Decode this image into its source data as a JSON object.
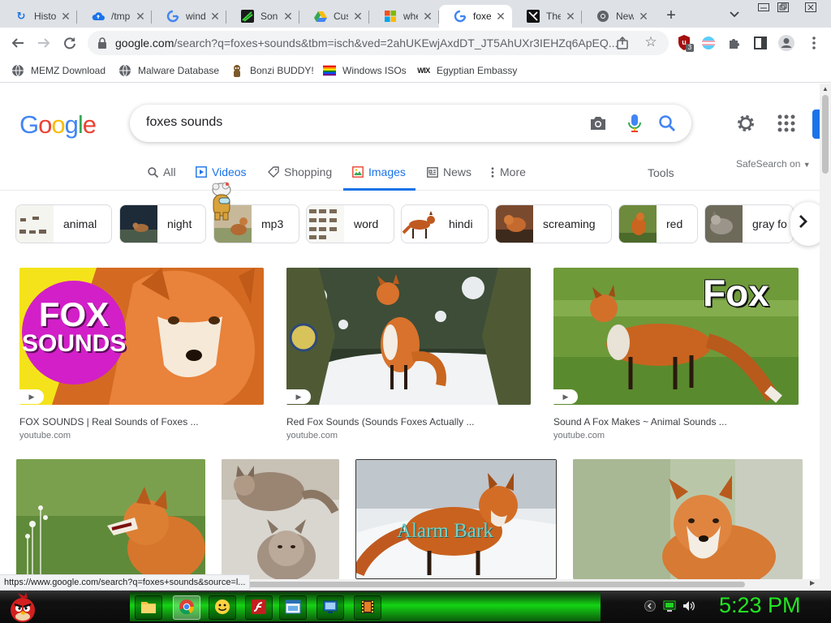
{
  "tabs": [
    {
      "title": "Histo",
      "icon": "history-icon"
    },
    {
      "title": "/tmp",
      "icon": "cloud-icon"
    },
    {
      "title": "wind",
      "icon": "google-icon"
    },
    {
      "title": "Soni",
      "icon": "sonic-icon"
    },
    {
      "title": "Cust",
      "icon": "drive-icon"
    },
    {
      "title": "whe",
      "icon": "microsoft-icon"
    },
    {
      "title": "foxe",
      "icon": "google-icon"
    },
    {
      "title": "The",
      "icon": "site-icon"
    },
    {
      "title": "New",
      "icon": "chrome-icon"
    }
  ],
  "toolbar": {
    "url_host": "google.com",
    "url_rest": "/search?q=foxes+sounds&tbm=isch&ved=2ahUKEwjAxdDT_JT5AhUXr3IEHZq6ApEQ...",
    "ext_badge": "3"
  },
  "bookmarks": [
    {
      "label": "MEMZ Download"
    },
    {
      "label": "Malware Database"
    },
    {
      "label": "Bonzi BUDDY!"
    },
    {
      "label": "Windows ISOs"
    },
    {
      "label": "Egyptian Embassy"
    }
  ],
  "google": {
    "logo": "Google",
    "query": "foxes sounds",
    "safesearch": "SafeSearch on",
    "tools": "Tools",
    "nav": [
      {
        "label": "All"
      },
      {
        "label": "Videos"
      },
      {
        "label": "Shopping"
      },
      {
        "label": "Images"
      },
      {
        "label": "News"
      },
      {
        "label": "More"
      }
    ],
    "chips": [
      {
        "label": "animal"
      },
      {
        "label": "night"
      },
      {
        "label": "mp3"
      },
      {
        "label": "word"
      },
      {
        "label": "hindi"
      },
      {
        "label": "screaming"
      },
      {
        "label": "red"
      },
      {
        "label": "gray fo"
      }
    ],
    "results": [
      {
        "title": "FOX SOUNDS | Real Sounds of Foxes ...",
        "source": "youtube.com",
        "badge_line1": "FOX",
        "badge_line2": "SOUNDS"
      },
      {
        "title": "Red Fox Sounds (Sounds Foxes Actually ...",
        "source": "youtube.com"
      },
      {
        "title": "Sound A Fox Makes ~ Animal Sounds ...",
        "source": "youtube.com",
        "overlay": "Fox"
      },
      {
        "overlay": "Alarm Bark"
      }
    ]
  },
  "status_url": "https://www.google.com/search?q=foxes+sounds&source=l...",
  "taskbar": {
    "clock": "5:23 PM"
  },
  "colors": {
    "accent": "#1a73e8",
    "clock": "#22e522",
    "taskbar_glow": "#14d414"
  }
}
